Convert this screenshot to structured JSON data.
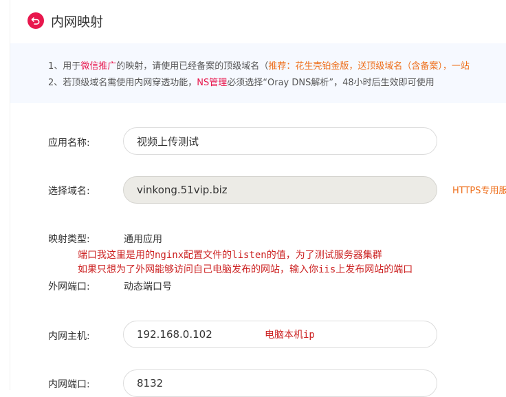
{
  "header": {
    "title": "内网映射",
    "back_icon": "back-arrow-icon",
    "accent": "#e8174d"
  },
  "notice": {
    "line1": {
      "prefix": "1、用于",
      "link": "微信推广",
      "middle": "的映射，请使用已经备案的顶级域名（",
      "highlight": "推荐：花生壳铂金版，送顶级域名（含备案），一站"
    },
    "line2": {
      "prefix": "2、若顶级域名需使用内网穿透功能，",
      "link": "NS管理",
      "suffix": "必须选择“Oray DNS解析”，48小时后生效即可使用"
    }
  },
  "form": {
    "app_name": {
      "label": "应用名称:",
      "value": "视频上传测试"
    },
    "domain": {
      "label": "选择域名:",
      "value": "vinkong.51vip.biz",
      "https_link": "HTTPS专用服"
    },
    "mapping_type": {
      "label": "映射类型:",
      "value": "通用应用"
    },
    "external_port": {
      "label": "外网端口:",
      "value": "动态端口号"
    },
    "internal_host": {
      "label": "内网主机:",
      "value": "192.168.0.102"
    },
    "internal_port": {
      "label": "内网端口:",
      "value": "8132"
    }
  },
  "annotations": {
    "port_note_1": "端口我这里是用的nginx配置文件的listen的值，为了测试服务器集群",
    "port_note_2": "如果只想为了外网能够访问自己电脑发布的网站，输入你iis上发布网站的端口",
    "host_note": "电脑本机ip"
  }
}
